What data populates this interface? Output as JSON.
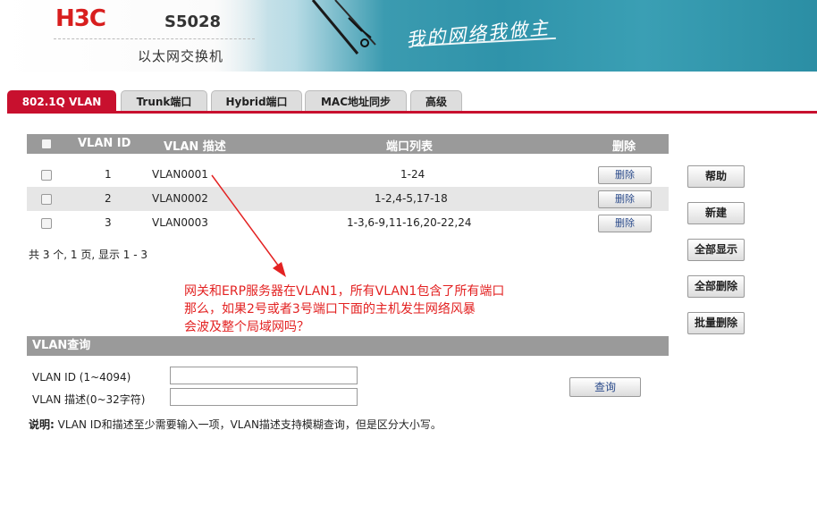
{
  "header": {
    "logo": "H3C",
    "model": "S5028",
    "subtitle": "以太网交换机",
    "slogan": "我的网络我做主",
    "colors": {
      "brand_red": "#d81e1e",
      "tab_red": "#c8102e",
      "banner_teal": "#2f93aa"
    }
  },
  "tabs": [
    {
      "label": "802.1Q VLAN",
      "active": true
    },
    {
      "label": "Trunk端口"
    },
    {
      "label": "Hybrid端口"
    },
    {
      "label": "MAC地址同步"
    },
    {
      "label": "高级"
    }
  ],
  "table": {
    "headers": {
      "id": "VLAN ID",
      "desc": "VLAN 描述",
      "ports": "端口列表",
      "delete": "删除"
    },
    "rows": [
      {
        "id": "1",
        "desc": "VLAN0001",
        "ports": "1-24",
        "delete_label": "删除"
      },
      {
        "id": "2",
        "desc": "VLAN0002",
        "ports": "1-2,4-5,17-18",
        "delete_label": "删除"
      },
      {
        "id": "3",
        "desc": "VLAN0003",
        "ports": "1-3,6-9,11-16,20-22,24",
        "delete_label": "删除"
      }
    ],
    "summary": "共 3 个, 1 页, 显示 1 - 3"
  },
  "side_buttons": [
    "帮助",
    "新建",
    "全部显示",
    "全部删除",
    "批量删除"
  ],
  "annotation": {
    "line1": "网关和ERP服务器在VLAN1，所有VLAN1包含了所有端口",
    "line2": "那么，如果2号或者3号端口下面的主机发生网络风暴",
    "line3": "会波及整个局域网吗？",
    "color": "#e32222"
  },
  "query": {
    "title": "VLAN查询",
    "id_label": "VLAN ID (1~4094)",
    "desc_label": "VLAN 描述(0~32字符)",
    "id_value": "",
    "desc_value": "",
    "button": "查询",
    "note_bold": "说明:",
    "note_text": " VLAN ID和描述至少需要输入一项，VLAN描述支持模糊查询，但是区分大小写。"
  }
}
